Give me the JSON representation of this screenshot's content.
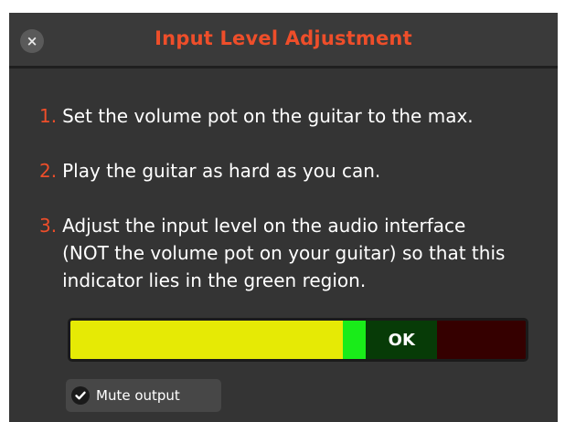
{
  "dialog": {
    "title": "Input Level Adjustment",
    "close_icon": "close-icon",
    "close_glyph": "×"
  },
  "steps": [
    {
      "number": "1.",
      "text": "Set the volume pot on the guitar to the max."
    },
    {
      "number": "2.",
      "text": "Play the guitar as hard as you can."
    },
    {
      "number": "3.",
      "text": "Adjust the input level on the audio interface (NOT the volume pot on your guitar) so that this indicator lies in the green region."
    }
  ],
  "meter": {
    "ok_label": "OK",
    "level": 0.6,
    "ok_zone": {
      "start": 0.6,
      "end": 0.805
    },
    "colors": {
      "low": "#e6ea05",
      "level": "#19ec19",
      "ok": "#073b07",
      "high": "#350000"
    }
  },
  "mute_output": {
    "label": "Mute output",
    "checked": true,
    "icon": "check-icon"
  },
  "colors": {
    "accent": "#ee4e2a",
    "background": "#343434"
  }
}
